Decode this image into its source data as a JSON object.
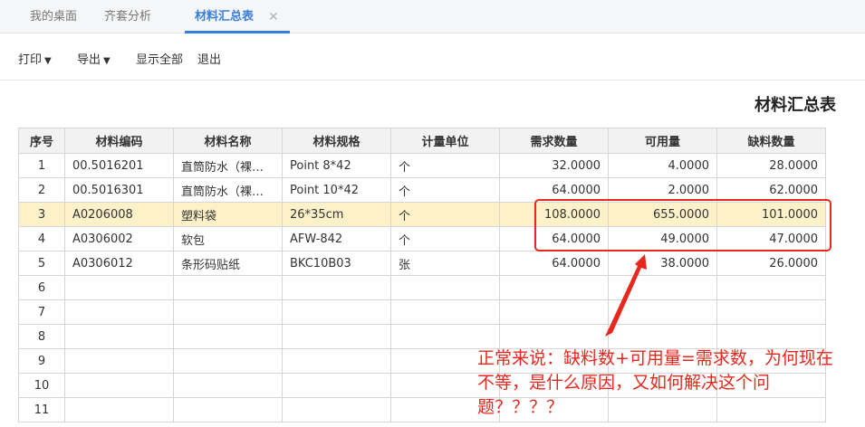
{
  "tabs": [
    {
      "label": "我的桌面"
    },
    {
      "label": "齐套分析"
    },
    {
      "label": "材料汇总表",
      "close": "✕"
    }
  ],
  "toolbar": {
    "print": "打印",
    "export": "导出",
    "show_all": "显示全部",
    "exit": "退出"
  },
  "report_title": "材料汇总表",
  "table": {
    "headers": [
      "序号",
      "材料编码",
      "材料名称",
      "材料规格",
      "计量单位",
      "需求数量",
      "可用量",
      "缺料数量"
    ],
    "rows": [
      [
        "1",
        "00.5016201",
        "直筒防水（裸…",
        "Point 8*42",
        "个",
        "32.0000",
        "4.0000",
        "28.0000"
      ],
      [
        "2",
        "00.5016301",
        "直筒防水（裸…",
        "Point 10*42",
        "个",
        "64.0000",
        "2.0000",
        "62.0000"
      ],
      [
        "3",
        "A0206008",
        "塑料袋",
        "26*35cm",
        "个",
        "108.0000",
        "655.0000",
        "101.0000"
      ],
      [
        "4",
        "A0306002",
        "软包",
        "AFW-842",
        "个",
        "64.0000",
        "49.0000",
        "47.0000"
      ],
      [
        "5",
        "A0306012",
        "条形码贴纸",
        "BKC10B03",
        "张",
        "64.0000",
        "38.0000",
        "26.0000"
      ],
      [
        "6",
        "",
        "",
        "",
        "",
        "",
        "",
        ""
      ],
      [
        "7",
        "",
        "",
        "",
        "",
        "",
        "",
        ""
      ],
      [
        "8",
        "",
        "",
        "",
        "",
        "",
        "",
        ""
      ],
      [
        "9",
        "",
        "",
        "",
        "",
        "",
        "",
        ""
      ],
      [
        "10",
        "",
        "",
        "",
        "",
        "",
        "",
        ""
      ],
      [
        "11",
        "",
        "",
        "",
        "",
        "",
        "",
        ""
      ]
    ],
    "highlighted_row": 3
  },
  "annotation": {
    "text": "正常来说：缺料数+可用量=需求数，为何现在不等，是什么原因，又如何解决这个问题？？？？",
    "color": "#e8281e"
  },
  "colors": {
    "accent": "#3b7ddd",
    "highlight_row": "#fcf1c8",
    "annotation_red": "#e8281e"
  }
}
